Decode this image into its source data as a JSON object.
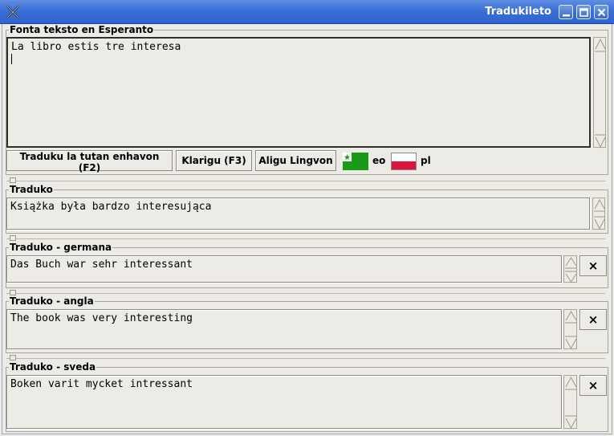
{
  "window": {
    "title": "Tradukileto"
  },
  "source": {
    "legend": "Fonta teksto en Esperanto",
    "text": "La libro estis tre interesa"
  },
  "toolbar": {
    "translate_label": "Traduku la tutan enhavon (F2)",
    "clarify_label": "Klarigu (F3)",
    "add_language_label": "Aligu Lingvon",
    "source_lang": "eo",
    "target_lang": "pl"
  },
  "translations": [
    {
      "legend": "Traduko",
      "text": "Książka była bardzo interesująca"
    },
    {
      "legend": "Traduko - germana",
      "text": "Das Buch war sehr interessant",
      "close_label": "×"
    },
    {
      "legend": "Traduko - angla",
      "text": "The book was very interesting",
      "close_label": "×"
    },
    {
      "legend": "Traduko - sveda",
      "text": "Boken varit mycket intressant",
      "close_label": "×"
    }
  ],
  "colors": {
    "titlebar": "#3a6fd8",
    "esperanto_flag": "#1a9a1a",
    "poland_white": "#ffffff",
    "poland_red": "#dc143c"
  }
}
